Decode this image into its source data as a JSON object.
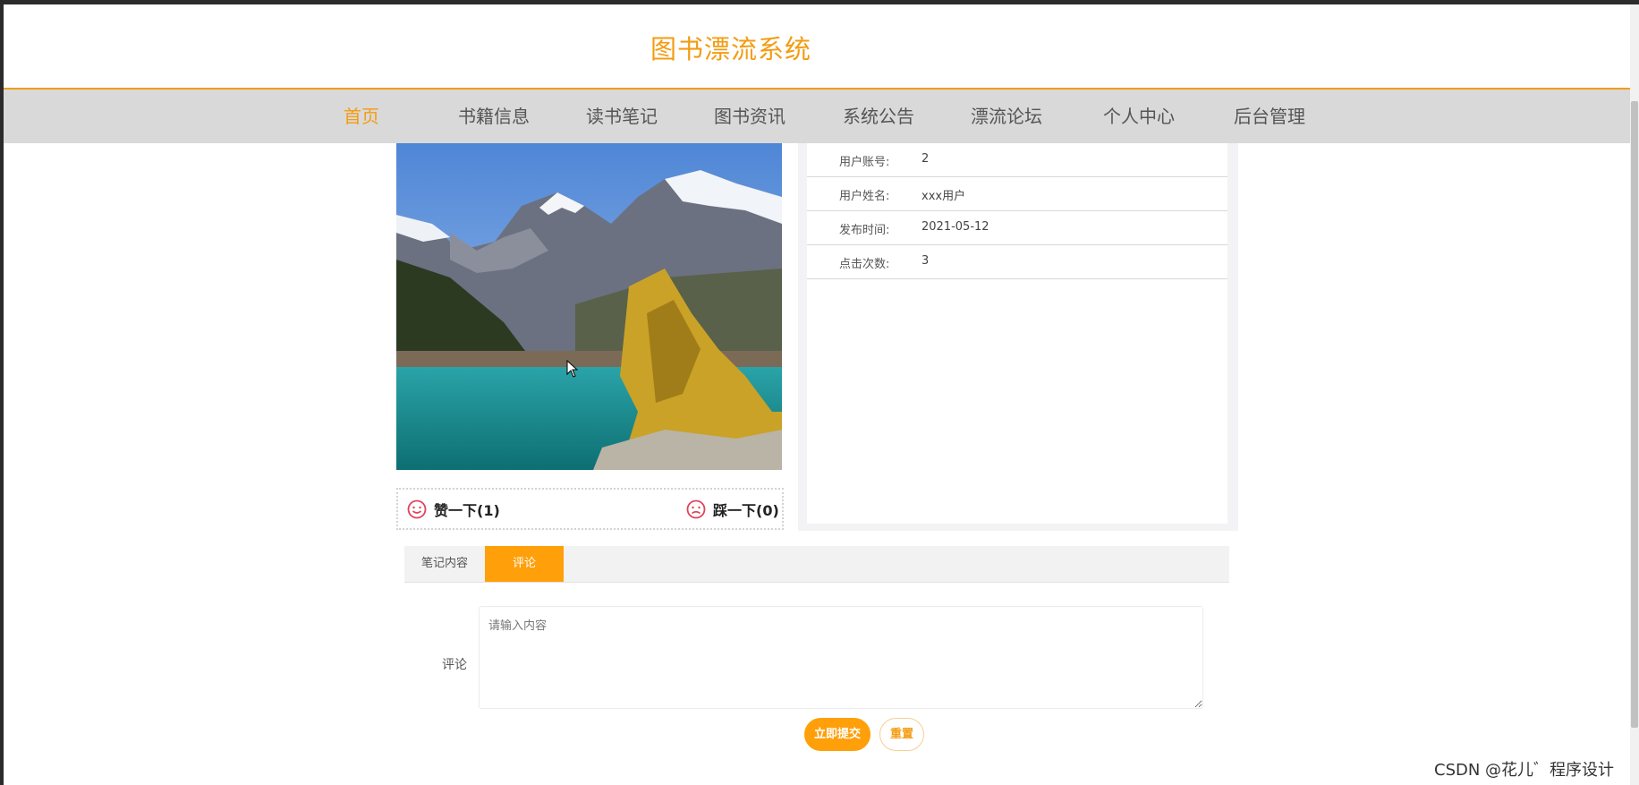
{
  "site": {
    "title": "图书漂流系统"
  },
  "nav": {
    "items": [
      "首页",
      "书籍信息",
      "读书笔记",
      "图书资讯",
      "系统公告",
      "漂流论坛",
      "个人中心",
      "后台管理"
    ],
    "active_index": 0
  },
  "votes": {
    "like_label": "赞一下(1)",
    "dislike_label": "踩一下(0)"
  },
  "info": {
    "rows": [
      {
        "label": "用户账号:",
        "value": "2"
      },
      {
        "label": "用户姓名:",
        "value": "xxx用户"
      },
      {
        "label": "发布时间:",
        "value": "2021-05-12"
      },
      {
        "label": "点击次数:",
        "value": "3"
      }
    ]
  },
  "tabs": {
    "items": [
      "笔记内容",
      "评论"
    ],
    "active_index": 1
  },
  "comment": {
    "label": "评论",
    "placeholder": "请输入内容",
    "value": ""
  },
  "buttons": {
    "submit_label": "立即提交",
    "reset_label": "重置"
  },
  "watermark": {
    "text": "CSDN @花儿゛程序设计"
  },
  "colors": {
    "accent": "#f39c12",
    "button": "#ff9f0a",
    "nav_bg": "#d9d9d9",
    "vote_icon": "#e0435c"
  }
}
